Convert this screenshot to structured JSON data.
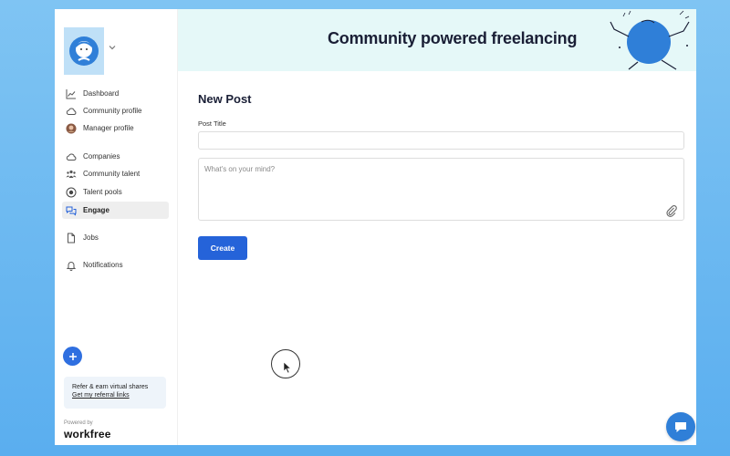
{
  "sidebar": {
    "items": [
      {
        "label": "Dashboard",
        "icon": "chart-line-icon"
      },
      {
        "label": "Community profile",
        "icon": "cloud-icon"
      },
      {
        "label": "Manager profile",
        "icon": "avatar-icon"
      },
      {
        "label": "Companies",
        "icon": "cloud-icon"
      },
      {
        "label": "Community talent",
        "icon": "people-icon"
      },
      {
        "label": "Talent pools",
        "icon": "target-icon"
      },
      {
        "label": "Engage",
        "icon": "chat-bubbles-icon",
        "active": true
      },
      {
        "label": "Jobs",
        "icon": "document-icon"
      },
      {
        "label": "Notifications",
        "icon": "bell-icon"
      }
    ],
    "referral": {
      "line1": "Refer & earn virtual shares",
      "link": "Get my referral links"
    },
    "powered_by": "Powered by",
    "brand": "workfree"
  },
  "banner": {
    "title": "Community powered freelancing"
  },
  "form": {
    "title": "New Post",
    "post_title_label": "Post Title",
    "post_title_value": "",
    "body_placeholder": "What's on your mind?",
    "create_label": "Create"
  },
  "colors": {
    "accent": "#2563d9",
    "banner_bg": "#e5f8f8",
    "page_bg": "#6fbaf1"
  }
}
